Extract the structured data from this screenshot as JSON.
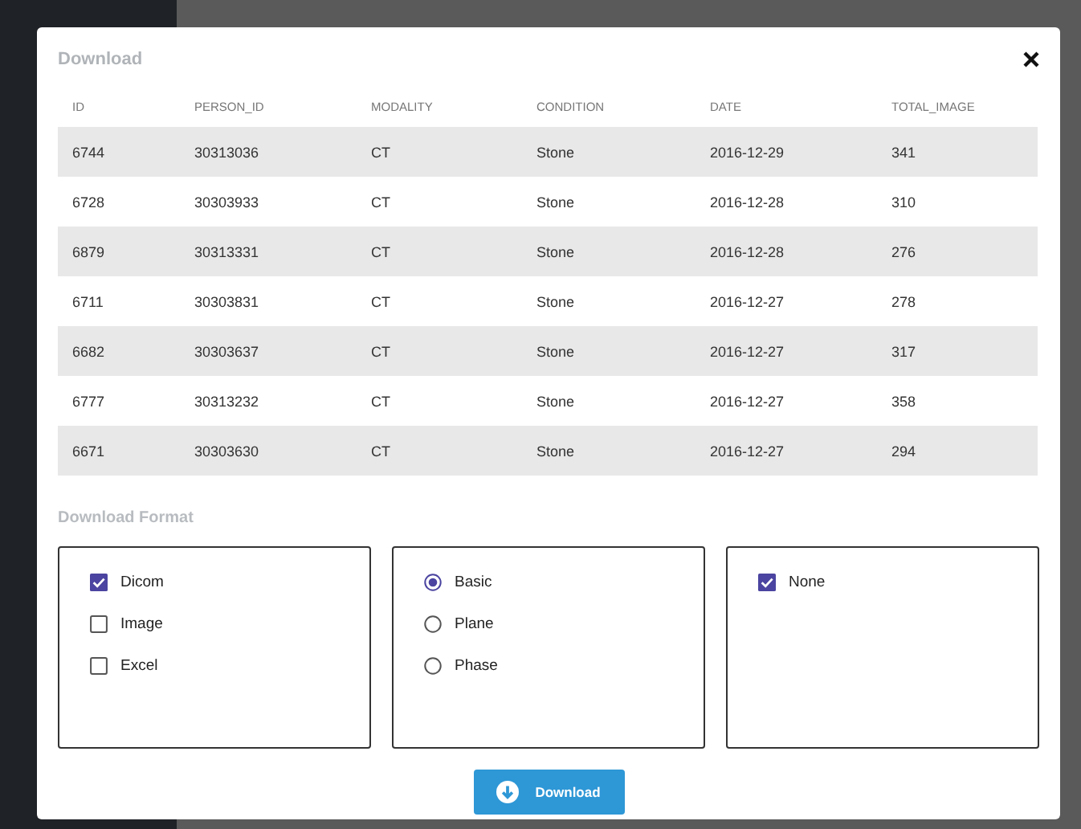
{
  "dialog": {
    "title": "Download"
  },
  "table": {
    "columns": [
      "ID",
      "PERSON_ID",
      "MODALITY",
      "CONDITION",
      "DATE",
      "TOTAL_IMAGE"
    ],
    "rows": [
      [
        "6744",
        "30313036",
        "CT",
        "Stone",
        "2016-12-29",
        "341"
      ],
      [
        "6728",
        "30303933",
        "CT",
        "Stone",
        "2016-12-28",
        "310"
      ],
      [
        "6879",
        "30313331",
        "CT",
        "Stone",
        "2016-12-28",
        "276"
      ],
      [
        "6711",
        "30303831",
        "CT",
        "Stone",
        "2016-12-27",
        "278"
      ],
      [
        "6682",
        "30303637",
        "CT",
        "Stone",
        "2016-12-27",
        "317"
      ],
      [
        "6777",
        "30313232",
        "CT",
        "Stone",
        "2016-12-27",
        "358"
      ],
      [
        "6671",
        "30303630",
        "CT",
        "Stone",
        "2016-12-27",
        "294"
      ]
    ]
  },
  "format_section": {
    "title": "Download Format",
    "groups": [
      {
        "kind": "checkbox",
        "options": [
          {
            "label": "Dicom",
            "checked": true
          },
          {
            "label": "Image",
            "checked": false
          },
          {
            "label": "Excel",
            "checked": false
          }
        ]
      },
      {
        "kind": "radio",
        "options": [
          {
            "label": "Basic",
            "selected": true
          },
          {
            "label": "Plane",
            "selected": false
          },
          {
            "label": "Phase",
            "selected": false
          }
        ]
      },
      {
        "kind": "checkbox",
        "options": [
          {
            "label": "None",
            "checked": true
          }
        ]
      }
    ]
  },
  "download_button": {
    "label": "Download"
  }
}
